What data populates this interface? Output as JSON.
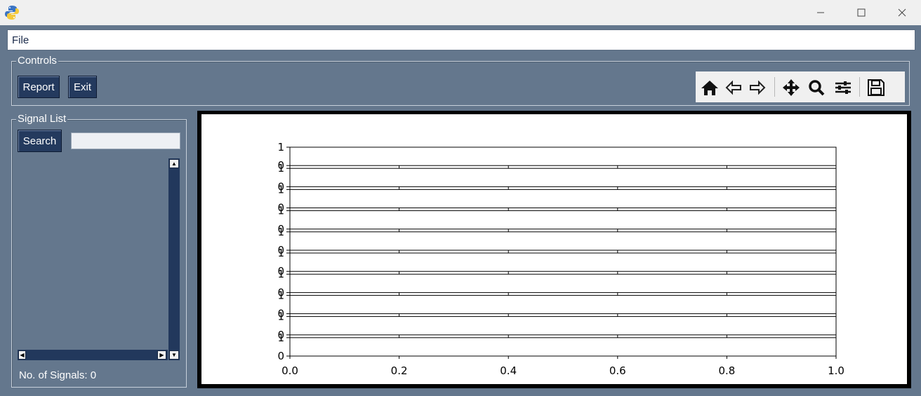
{
  "window": {
    "minimize_icon": "minimize-icon",
    "maximize_icon": "maximize-icon",
    "close_icon": "close-icon"
  },
  "menu": {
    "file_label": "File"
  },
  "controls": {
    "title": "Controls",
    "report_label": "Report",
    "exit_label": "Exit"
  },
  "toolbar": {
    "icons": [
      "home-icon",
      "back-icon",
      "forward-icon",
      "pan-icon",
      "zoom-icon",
      "configure-subplots-icon",
      "save-icon"
    ]
  },
  "signal_list": {
    "title": "Signal List",
    "search_label": "Search",
    "search_value": "",
    "count_label": "No. of Signals: 0"
  },
  "colors": {
    "background": "#64778d",
    "button": "#243a5e",
    "plot_border": "#000000"
  },
  "chart_data": {
    "type": "line",
    "subplots": 10,
    "series": [],
    "x_ticks": [
      "0.0",
      "0.2",
      "0.4",
      "0.6",
      "0.8",
      "1.0"
    ],
    "xlim": [
      0,
      1
    ],
    "ylim": [
      0,
      1
    ],
    "y_tick_labels": [
      "0",
      "1"
    ]
  }
}
